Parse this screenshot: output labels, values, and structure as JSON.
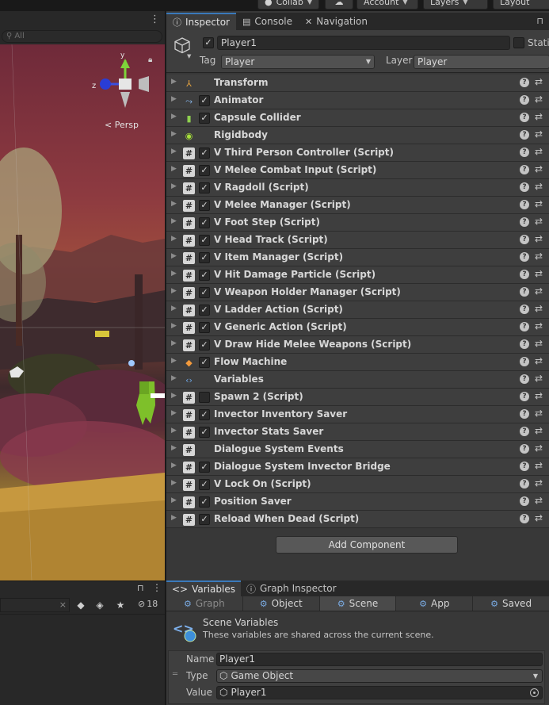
{
  "toolbar": {
    "collab_label": "Collab",
    "account_label": "Account",
    "layers_label": "Layers",
    "layout_label": "Layout"
  },
  "scene": {
    "search_placeholder": "All",
    "persp_label": "Persp"
  },
  "hierarchy": {
    "count": "18"
  },
  "inspector": {
    "tabs": [
      {
        "label": "Inspector",
        "icon": "info-icon"
      },
      {
        "label": "Console",
        "icon": "console-icon"
      },
      {
        "label": "Navigation",
        "icon": "navigation-icon"
      }
    ],
    "gameobject": {
      "name": "Player1",
      "active": true,
      "static_label": "Static",
      "tag_label": "Tag",
      "tag_value": "Player",
      "layer_label": "Layer",
      "layer_value": "Player"
    },
    "components": [
      {
        "name": "Transform",
        "icon": "transform-icon",
        "checkbox": "none"
      },
      {
        "name": "Animator",
        "icon": "animator-icon",
        "checkbox": "checked"
      },
      {
        "name": "Capsule Collider",
        "icon": "capsule-collider-icon",
        "checkbox": "checked"
      },
      {
        "name": "Rigidbody",
        "icon": "rigidbody-icon",
        "checkbox": "none"
      },
      {
        "name": "V Third Person Controller (Script)",
        "icon": "script-icon",
        "checkbox": "checked"
      },
      {
        "name": "V Melee Combat Input (Script)",
        "icon": "script-icon",
        "checkbox": "checked"
      },
      {
        "name": "V Ragdoll (Script)",
        "icon": "script-icon",
        "checkbox": "checked"
      },
      {
        "name": "V Melee Manager (Script)",
        "icon": "script-icon",
        "checkbox": "checked"
      },
      {
        "name": "V Foot Step (Script)",
        "icon": "script-icon",
        "checkbox": "checked"
      },
      {
        "name": "V Head Track (Script)",
        "icon": "script-icon",
        "checkbox": "checked"
      },
      {
        "name": "V Item Manager (Script)",
        "icon": "script-icon",
        "checkbox": "checked"
      },
      {
        "name": "V Hit Damage Particle (Script)",
        "icon": "script-icon",
        "checkbox": "checked"
      },
      {
        "name": "V Weapon Holder Manager (Script)",
        "icon": "script-icon",
        "checkbox": "checked"
      },
      {
        "name": "V Ladder Action (Script)",
        "icon": "script-icon",
        "checkbox": "checked"
      },
      {
        "name": "V Generic Action (Script)",
        "icon": "script-icon",
        "checkbox": "checked"
      },
      {
        "name": "V Draw Hide Melee Weapons (Script)",
        "icon": "script-icon",
        "checkbox": "checked"
      },
      {
        "name": "Flow Machine",
        "icon": "flow-machine-icon",
        "checkbox": "checked"
      },
      {
        "name": "Variables",
        "icon": "variables-icon",
        "checkbox": "none"
      },
      {
        "name": "Spawn 2 (Script)",
        "icon": "script-icon",
        "checkbox": "unchecked"
      },
      {
        "name": "Invector Inventory Saver",
        "icon": "script-icon",
        "checkbox": "checked"
      },
      {
        "name": "Invector Stats Saver",
        "icon": "script-icon",
        "checkbox": "checked"
      },
      {
        "name": "Dialogue System Events",
        "icon": "script-icon",
        "checkbox": "none"
      },
      {
        "name": "Dialogue System Invector Bridge",
        "icon": "script-icon",
        "checkbox": "checked"
      },
      {
        "name": "V Lock On (Script)",
        "icon": "script-icon",
        "checkbox": "checked"
      },
      {
        "name": "Position Saver",
        "icon": "script-icon",
        "checkbox": "checked"
      },
      {
        "name": "Reload When Dead (Script)",
        "icon": "script-icon",
        "checkbox": "checked"
      }
    ],
    "add_component_label": "Add Component"
  },
  "variables_panel": {
    "tabs": [
      {
        "label": "Variables",
        "icon": "code-brackets-icon"
      },
      {
        "label": "Graph Inspector",
        "icon": "info-icon"
      }
    ],
    "scopes": [
      {
        "label": "Graph",
        "dim": true
      },
      {
        "label": "Object",
        "dim": false
      },
      {
        "label": "Scene",
        "dim": false
      },
      {
        "label": "App",
        "dim": false
      },
      {
        "label": "Saved",
        "dim": false
      }
    ],
    "title": "Scene Variables",
    "description": "These variables are shared across the current scene.",
    "entry": {
      "name_label": "Name",
      "name_value": "Player1",
      "type_label": "Type",
      "type_value": "Game Object",
      "value_label": "Value",
      "value_value": "Player1"
    }
  },
  "colors": {
    "accent": "#3a79bb",
    "panel": "#383838",
    "header": "#282828"
  }
}
